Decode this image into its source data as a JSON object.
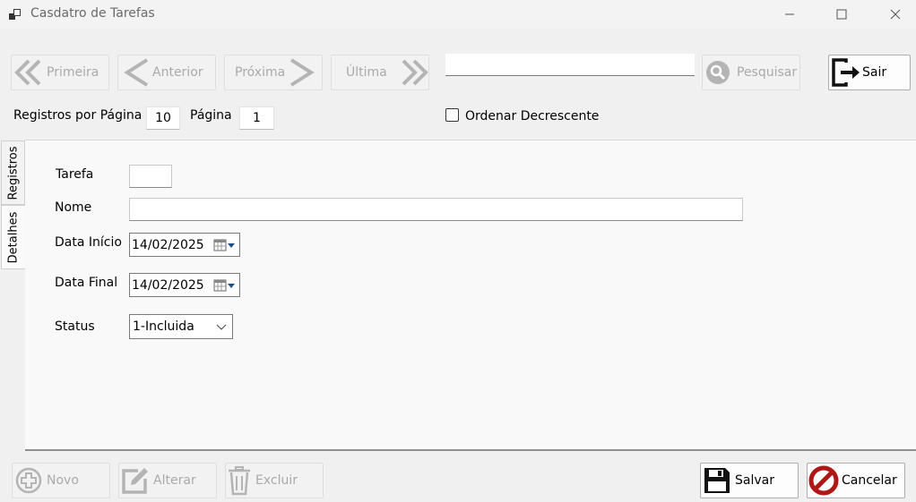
{
  "window": {
    "title": "Casdatro de Tarefas"
  },
  "nav": {
    "first_label": "Primeira",
    "prev_label": "Anterior",
    "next_label": "Próxima",
    "last_label": "Última",
    "search_value": "",
    "search_label": "Pesquisar",
    "exit_label": "Sair"
  },
  "paging": {
    "per_page_label": "Registros por Página",
    "per_page_value": "10",
    "page_label": "Página",
    "page_value": "1",
    "sort_desc_label": "Ordenar Decrescente",
    "sort_desc_checked": false
  },
  "tabs": {
    "records_label": "Registros",
    "details_label": "Detalhes"
  },
  "form": {
    "tarefa_label": "Tarefa",
    "tarefa_value": "",
    "nome_label": "Nome",
    "nome_value": "",
    "data_inicio_label": "Data Início",
    "data_inicio_value": "14/02/2025",
    "data_final_label": "Data Final",
    "data_final_value": "14/02/2025",
    "status_label": "Status",
    "status_value": "1-Incluida"
  },
  "actions": {
    "novo_label": "Novo",
    "alterar_label": "Alterar",
    "excluir_label": "Excluir",
    "salvar_label": "Salvar",
    "cancelar_label": "Cancelar"
  },
  "colors": {
    "disabled_icon": "#b4b4b4",
    "cancel_red": "#b01818",
    "enabled_icon": "#111111"
  }
}
